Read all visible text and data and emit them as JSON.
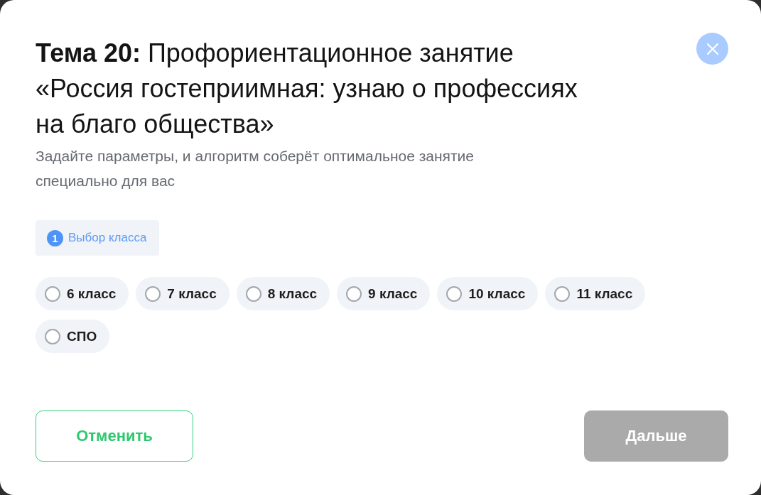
{
  "dialog": {
    "title": "**Тема 20:** Профориентационное занятие «Россия гостеприимная: узнаю о профессиях на благо общества»",
    "subtitle": "Задайте параметры, и алгоритм соберёт оптимальное занятие специально для вас"
  },
  "steps": [
    {
      "number": "1",
      "label": "Выбор класса",
      "selected": true
    }
  ],
  "options": [
    {
      "label": "6 класс",
      "selected": false
    },
    {
      "label": "7 класс",
      "selected": false
    },
    {
      "label": "8 класс",
      "selected": false
    },
    {
      "label": "9 класс",
      "selected": false
    },
    {
      "label": "10 класс",
      "selected": false
    },
    {
      "label": "11 класс",
      "selected": false
    },
    {
      "label": "СПО",
      "selected": false
    }
  ],
  "buttons": [
    {
      "label": "Отменить",
      "kind": "outline",
      "disabled": false
    },
    {
      "label": "Дальше",
      "kind": "primary",
      "disabled": true
    }
  ]
}
